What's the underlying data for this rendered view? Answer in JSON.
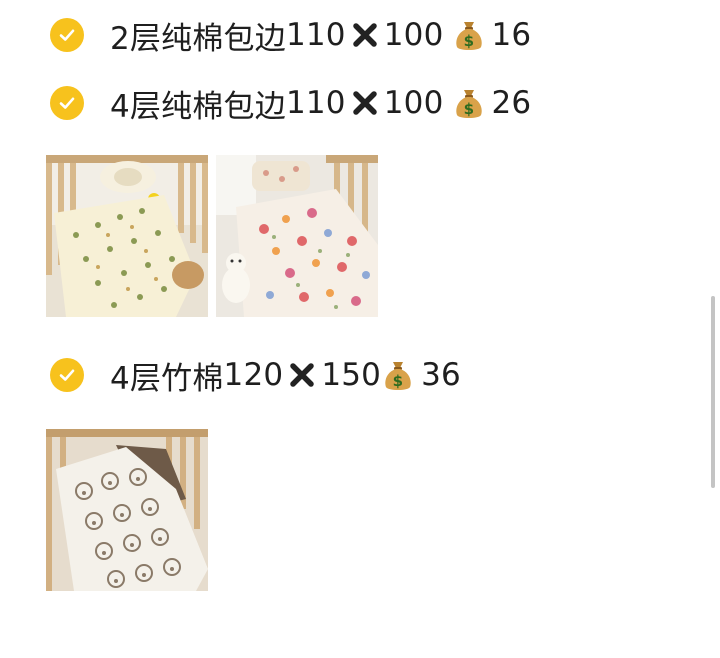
{
  "items": [
    {
      "desc": "2层纯棉包边",
      "size_a": "110",
      "size_b": "100",
      "price": "16"
    },
    {
      "desc": "4层纯棉包边",
      "size_a": "110",
      "size_b": "100",
      "price": "26"
    },
    {
      "desc": "4层竹棉",
      "size_a": "120",
      "size_b": "150",
      "price": "36"
    }
  ],
  "icons": {
    "check": "check-circle-icon",
    "times": "heavy-multiplication-x-icon",
    "money": "money-bag-icon"
  },
  "colors": {
    "check_bg": "#f7c21d",
    "text": "#1f1f1f",
    "cross": "#222222",
    "money_bag": "#d9a24a"
  }
}
